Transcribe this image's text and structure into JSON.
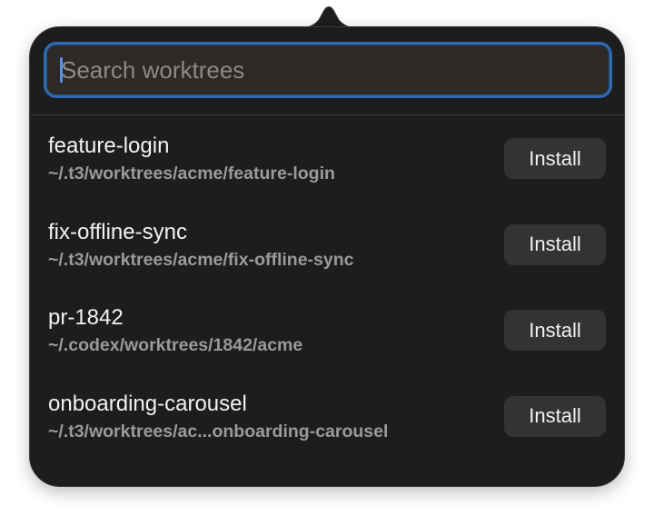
{
  "search": {
    "placeholder": "Search worktrees",
    "value": ""
  },
  "worktrees": [
    {
      "name": "feature-login",
      "path": "~/.t3/worktrees/acme/feature-login",
      "action": "Install"
    },
    {
      "name": "fix-offline-sync",
      "path": "~/.t3/worktrees/acme/fix-offline-sync",
      "action": "Install"
    },
    {
      "name": "pr-1842",
      "path": "~/.codex/worktrees/1842/acme",
      "action": "Install"
    },
    {
      "name": "onboarding-carousel",
      "path": "~/.t3/worktrees/ac...onboarding-carousel",
      "action": "Install"
    }
  ],
  "colors": {
    "panel": "#1d1d1f",
    "focus_ring": "#2f6bb0",
    "button": "#333335"
  }
}
